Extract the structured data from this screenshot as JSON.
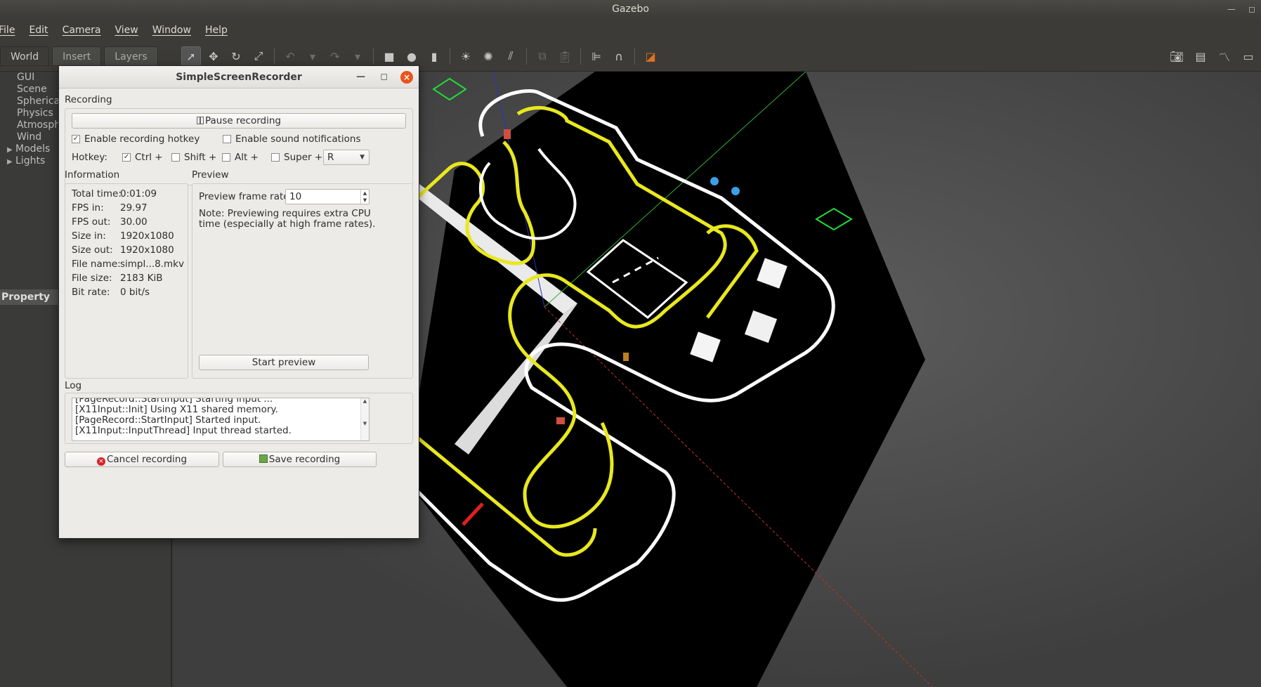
{
  "app": {
    "title": "Gazebo"
  },
  "menubar": [
    "File",
    "Edit",
    "Camera",
    "View",
    "Window",
    "Help"
  ],
  "tabs": [
    "World",
    "Insert",
    "Layers"
  ],
  "world_tree": [
    {
      "label": "GUI",
      "expandable": false
    },
    {
      "label": "Scene",
      "expandable": false
    },
    {
      "label": "Spherica",
      "expandable": false
    },
    {
      "label": "Physics",
      "expandable": false
    },
    {
      "label": "Atmosph",
      "expandable": false
    },
    {
      "label": "Wind",
      "expandable": false
    },
    {
      "label": "Models",
      "expandable": true
    },
    {
      "label": "Lights",
      "expandable": true
    }
  ],
  "property_header": "Property",
  "recorder": {
    "title": "SimpleScreenRecorder",
    "recording": {
      "label": "Recording",
      "pause_button": "Pause recording",
      "enable_hotkey": "Enable recording hotkey",
      "enable_hotkey_checked": true,
      "enable_sound": "Enable sound notifications",
      "enable_sound_checked": false,
      "hotkey_label": "Hotkey:",
      "ctrl": "Ctrl +",
      "ctrl_checked": true,
      "shift": "Shift +",
      "shift_checked": false,
      "alt": "Alt +",
      "alt_checked": false,
      "super": "Super +",
      "super_checked": false,
      "key": "R"
    },
    "information": {
      "label": "Information",
      "rows": [
        {
          "key": "Total time:",
          "value": "0:01:09"
        },
        {
          "key": "FPS in:",
          "value": "29.97"
        },
        {
          "key": "FPS out:",
          "value": "30.00"
        },
        {
          "key": "Size in:",
          "value": "1920x1080"
        },
        {
          "key": "Size out:",
          "value": "1920x1080"
        },
        {
          "key": "File name:",
          "value": "simpl...8.mkv"
        },
        {
          "key": "File size:",
          "value": "2183 KiB"
        },
        {
          "key": "Bit rate:",
          "value": "0 bit/s"
        }
      ]
    },
    "preview": {
      "label": "Preview",
      "frame_rate_label": "Preview frame rate:",
      "frame_rate_value": "10",
      "note_line1": "Note: Previewing requires extra CPU",
      "note_line2": "time (especially at high frame rates).",
      "start_button": "Start preview"
    },
    "log": {
      "label": "Log",
      "lines": [
        "[PageRecord::StartInput] Starting input ...",
        "[X11Input::Init] Using X11 shared memory.",
        "[PageRecord::StartInput] Started input.",
        "[X11Input::InputThread] Input thread started."
      ]
    },
    "cancel_button": "Cancel recording",
    "save_button": "Save recording"
  },
  "colors": {
    "track_yellow": "#e8e81e",
    "track_white": "#ffffff",
    "ground": "#000000",
    "close_button": "#e9541c"
  }
}
